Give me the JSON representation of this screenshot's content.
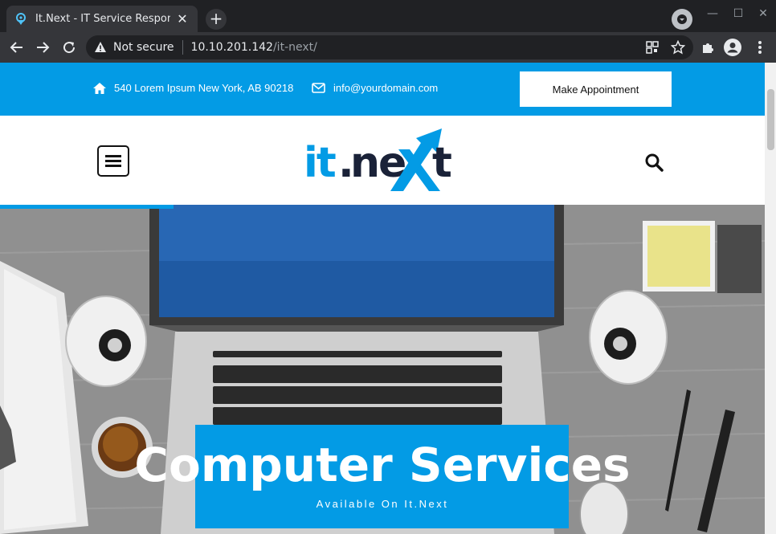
{
  "browser": {
    "tab_title": "It.Next - IT Service Respon",
    "tab_close": "✕",
    "new_tab": "+",
    "window_min": "—",
    "window_max": "☐",
    "window_close": "✕",
    "not_secure": "Not secure",
    "url_host": "10.10.201.142",
    "url_path": "/it-next/"
  },
  "topbar": {
    "address": "540 Lorem Ipsum New York, AB 90218",
    "email": "info@yourdomain.com",
    "appointment_label": "Make Appointment"
  },
  "logo": {
    "text": "it.next"
  },
  "hero": {
    "title": "Computer Services",
    "subtitle": "Available On It.Next"
  },
  "colors": {
    "accent": "#039be5",
    "logo_dark": "#1a2238"
  }
}
